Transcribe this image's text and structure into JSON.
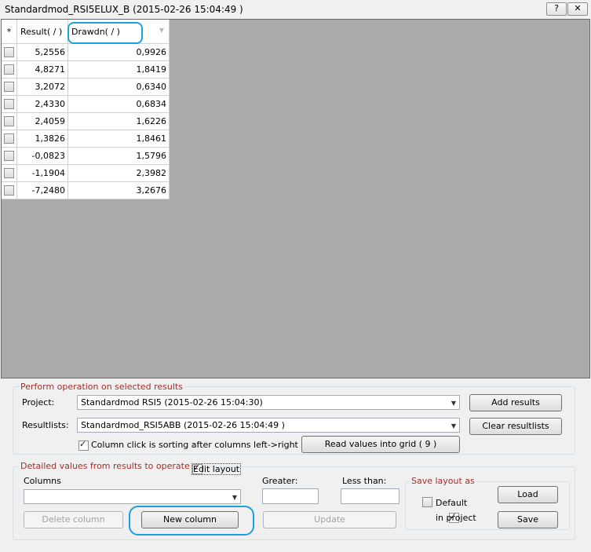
{
  "window": {
    "title": "Standardmod_RSI5ELUX_B  (2015-02-26 15:04:49 )",
    "help_label": "?",
    "close_label": "✕"
  },
  "grid": {
    "corner_label": "*",
    "columns": [
      "Result( / )",
      "Drawdn( / )"
    ],
    "rows": [
      {
        "checked": false,
        "result": "5,2556",
        "drawdn": "0,9926"
      },
      {
        "checked": false,
        "result": "4,8271",
        "drawdn": "1,8419"
      },
      {
        "checked": false,
        "result": "3,2072",
        "drawdn": "0,6340"
      },
      {
        "checked": false,
        "result": "2,4330",
        "drawdn": "0,6834"
      },
      {
        "checked": false,
        "result": "2,4059",
        "drawdn": "1,6226"
      },
      {
        "checked": false,
        "result": "1,3826",
        "drawdn": "1,8461"
      },
      {
        "checked": false,
        "result": "-0,0823",
        "drawdn": "1,5796"
      },
      {
        "checked": false,
        "result": "-1,1904",
        "drawdn": "2,3982"
      },
      {
        "checked": false,
        "result": "-7,2480",
        "drawdn": "3,2676"
      }
    ]
  },
  "perform": {
    "group_label": "Perform operation on selected results",
    "project_label": "Project:",
    "project_value": "Standardmod RSI5  (2015-02-26 15:04:30)",
    "resultlists_label": "Resultlists:",
    "resultlists_value": "Standardmod_RSI5ABB  (2015-02-26 15:04:49 )",
    "add_results": "Add results",
    "clear_resultlists": "Clear resultlists",
    "sort_checkbox_label": "Column click is sorting after columns left->right",
    "sort_checked": true,
    "read_values": "Read values into grid ( 9 )"
  },
  "detailed": {
    "group_label": "Detailed values from results to operate on",
    "edit_layout_label": "Edit layout",
    "edit_layout_checked": true,
    "columns_label": "Columns",
    "columns_value": "",
    "greater_label": "Greater:",
    "greater_value": "",
    "less_than_label": "Less than:",
    "less_than_value": "",
    "delete_column": "Delete column",
    "new_column": "New column",
    "update": "Update"
  },
  "save_layout": {
    "group_label": "Save layout as",
    "default_label": "Default",
    "default_checked": false,
    "in_project_label": "in project",
    "in_project_checked": true,
    "load": "Load",
    "save": "Save"
  },
  "colors": {
    "group_label_red": "#a0302a",
    "highlight_blue": "#1ca0e0",
    "grid_background": "#aaaaaa"
  }
}
